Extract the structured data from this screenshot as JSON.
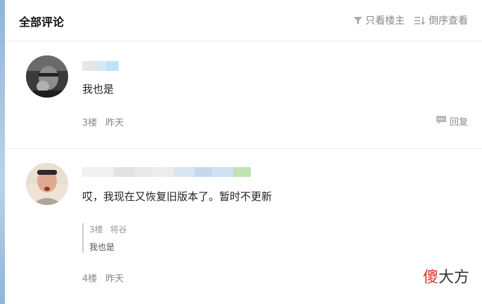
{
  "header": {
    "title": "全部评论",
    "filter_label": "只看楼主",
    "sort_label": "倒序查看"
  },
  "comments": [
    {
      "text": "我也是",
      "floor": "3楼",
      "time": "昨天",
      "reply_label": "回复"
    },
    {
      "text": "哎，我现在又恢复旧版本了。暂时不更新",
      "floor": "4楼",
      "time": "昨天",
      "quote": {
        "floor": "3楼",
        "author": "将谷",
        "text": "我也是"
      }
    }
  ],
  "watermark": {
    "part1": "傻",
    "part2": "大方"
  },
  "icons": {
    "filter": "filter-icon",
    "sort": "sort-icon",
    "reply": "reply-icon"
  }
}
